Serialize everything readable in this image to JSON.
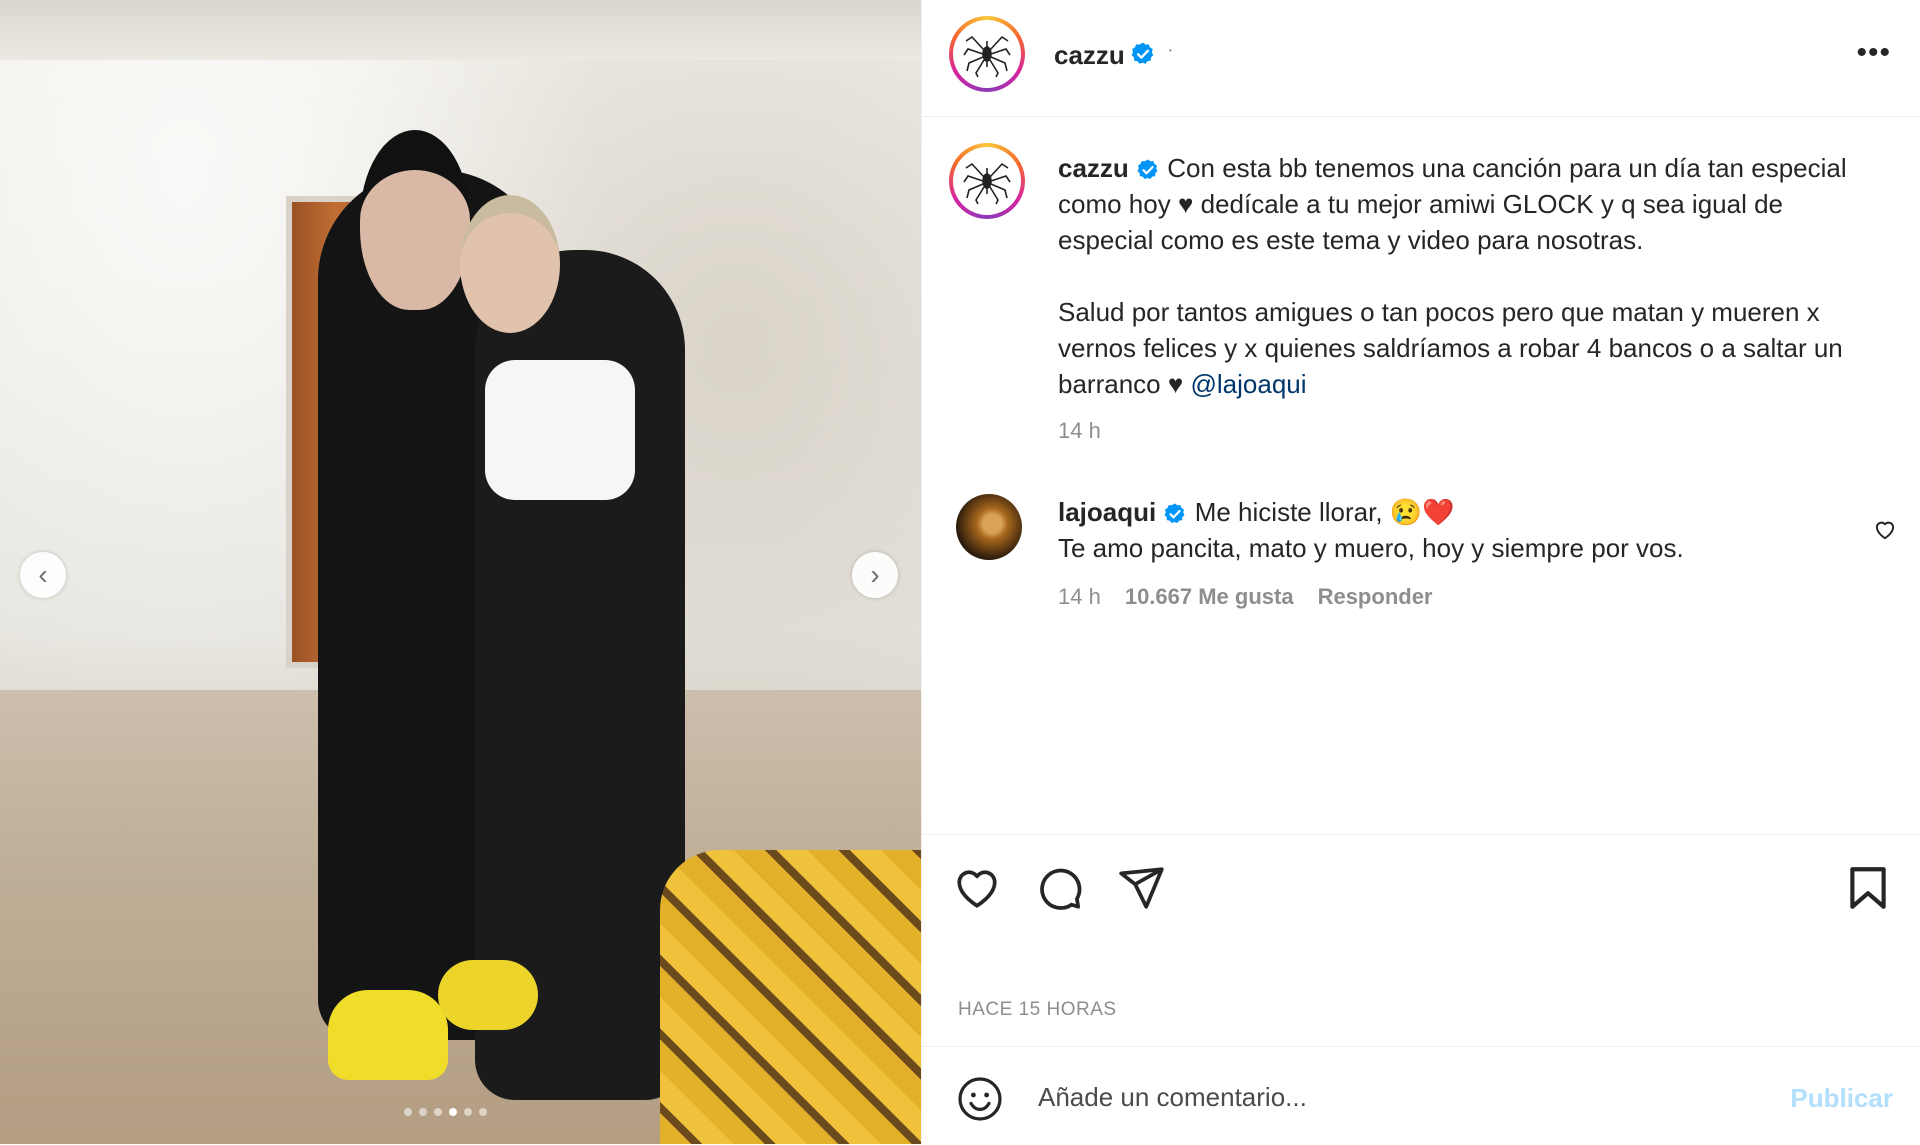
{
  "post": {
    "username": "cazzu",
    "header_separator": "·",
    "more_label": "•••"
  },
  "caption": {
    "username": "cazzu",
    "text_line1": "Con esta bb tenemos una canción para un día tan especial como hoy ♥︎ dedícale a tu mejor amiwi GLOCK y q sea igual de especial como es este tema y video para nosotras.",
    "text_line2": "Salud por tantos amigues o tan pocos pero que matan y mueren x vernos felices y x quienes saldríamos a robar 4 bancos o a saltar un barranco ♥︎ ",
    "mention": "@lajoaqui",
    "time": "14 h"
  },
  "comment": {
    "username": "lajoaqui",
    "text_line1": "Me hiciste llorar, 😢❤️",
    "text_line2": "Te amo pancita, mato y muero, hoy y siempre por vos.",
    "time": "14 h",
    "likes": "10.667 Me gusta",
    "reply": "Responder"
  },
  "actions": {
    "posted_ago": "HACE 15 HORAS"
  },
  "composer": {
    "placeholder": "Añade un comentario...",
    "publish": "Publicar"
  },
  "media": {
    "prev_arrow": "‹",
    "next_arrow": "›",
    "carousel_count": 6,
    "carousel_active_index": 3
  },
  "colors": {
    "verified": "#0095f6",
    "mention": "#00376b",
    "publish_disabled": "#b2dffc"
  },
  "icons": [
    "spider-logo-icon",
    "verified-icon",
    "more-icon",
    "heart-icon",
    "comment-icon",
    "share-icon",
    "bookmark-icon",
    "emoji-icon",
    "chevron-left-icon",
    "chevron-right-icon"
  ]
}
